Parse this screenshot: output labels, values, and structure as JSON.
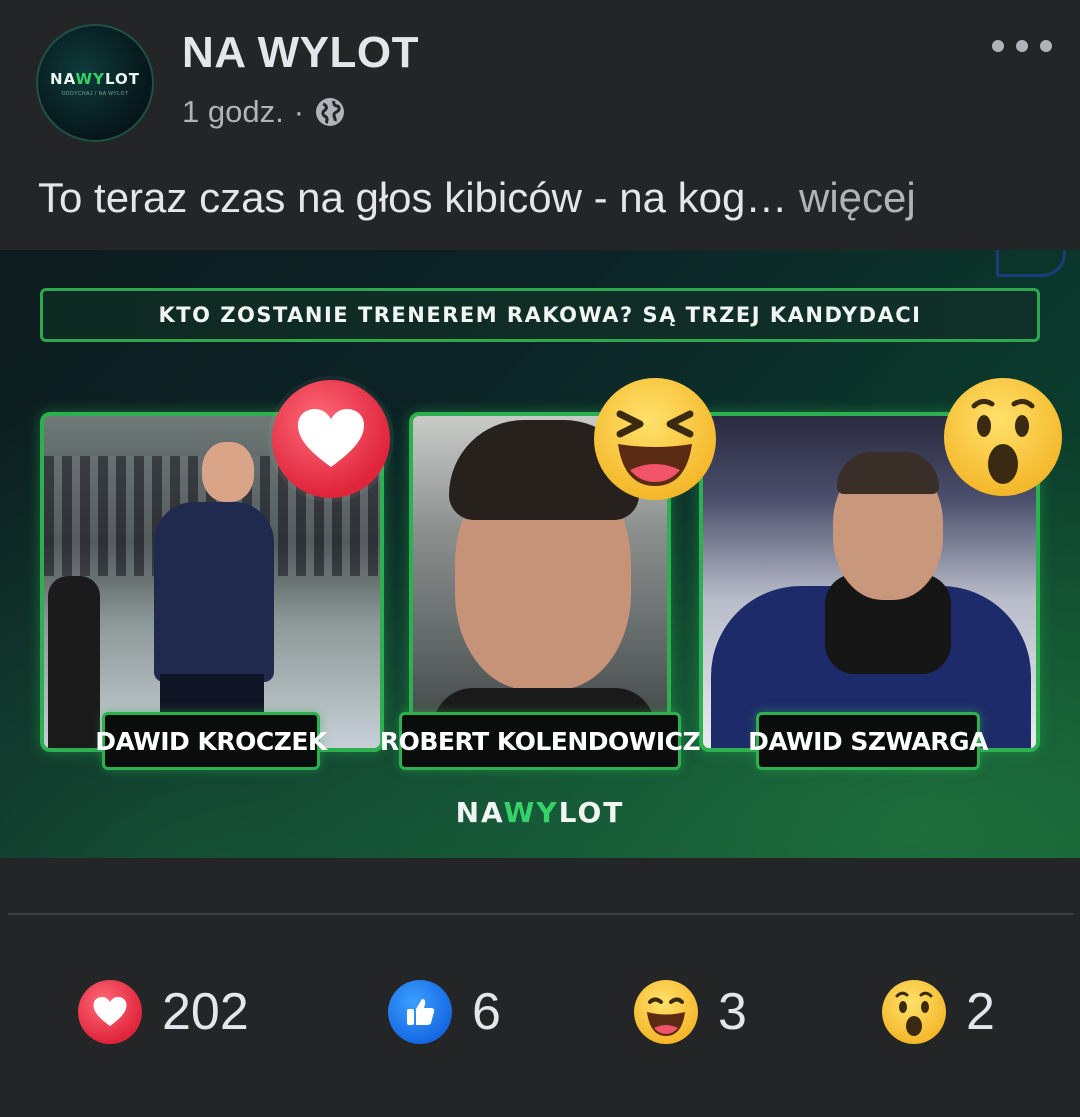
{
  "post": {
    "page_name": "NA WYLOT",
    "avatar_logo": {
      "left": "NA",
      "slash": "WY",
      "right": "LOT"
    },
    "avatar_sub": "ODDYCHAJ / NA WYLOT",
    "time": "1 godz.",
    "separator": "·",
    "text": "To teraz czas na głos kibiców - na kog…",
    "more_link": "więcej"
  },
  "image": {
    "banner": "KTO ZOSTANIE TRENEREM RAKOWA? SĄ TRZEJ KANDYDACI",
    "candidates": [
      {
        "name": "DAWID KROCZEK",
        "reaction": "heart-icon"
      },
      {
        "name": "ROBERT KOLENDOWICZ",
        "reaction": "laugh-emoji-icon"
      },
      {
        "name": "DAWID SZWARGA",
        "reaction": "wow-emoji-icon"
      }
    ],
    "logo": {
      "left": "NA",
      "slash": "WY",
      "right": "LOT"
    }
  },
  "reactions": [
    {
      "type": "love",
      "icon": "heart-icon",
      "count": "202"
    },
    {
      "type": "like",
      "icon": "thumbs-up-icon",
      "count": "6"
    },
    {
      "type": "haha",
      "icon": "laugh-emoji-icon",
      "count": "3"
    },
    {
      "type": "wow",
      "icon": "wow-emoji-icon",
      "count": "2"
    }
  ],
  "colors": {
    "background": "#242526",
    "accent_green": "#2db04f",
    "love": "#e0253b",
    "like": "#1466e0",
    "emoji_yellow": "#f4b72a"
  }
}
